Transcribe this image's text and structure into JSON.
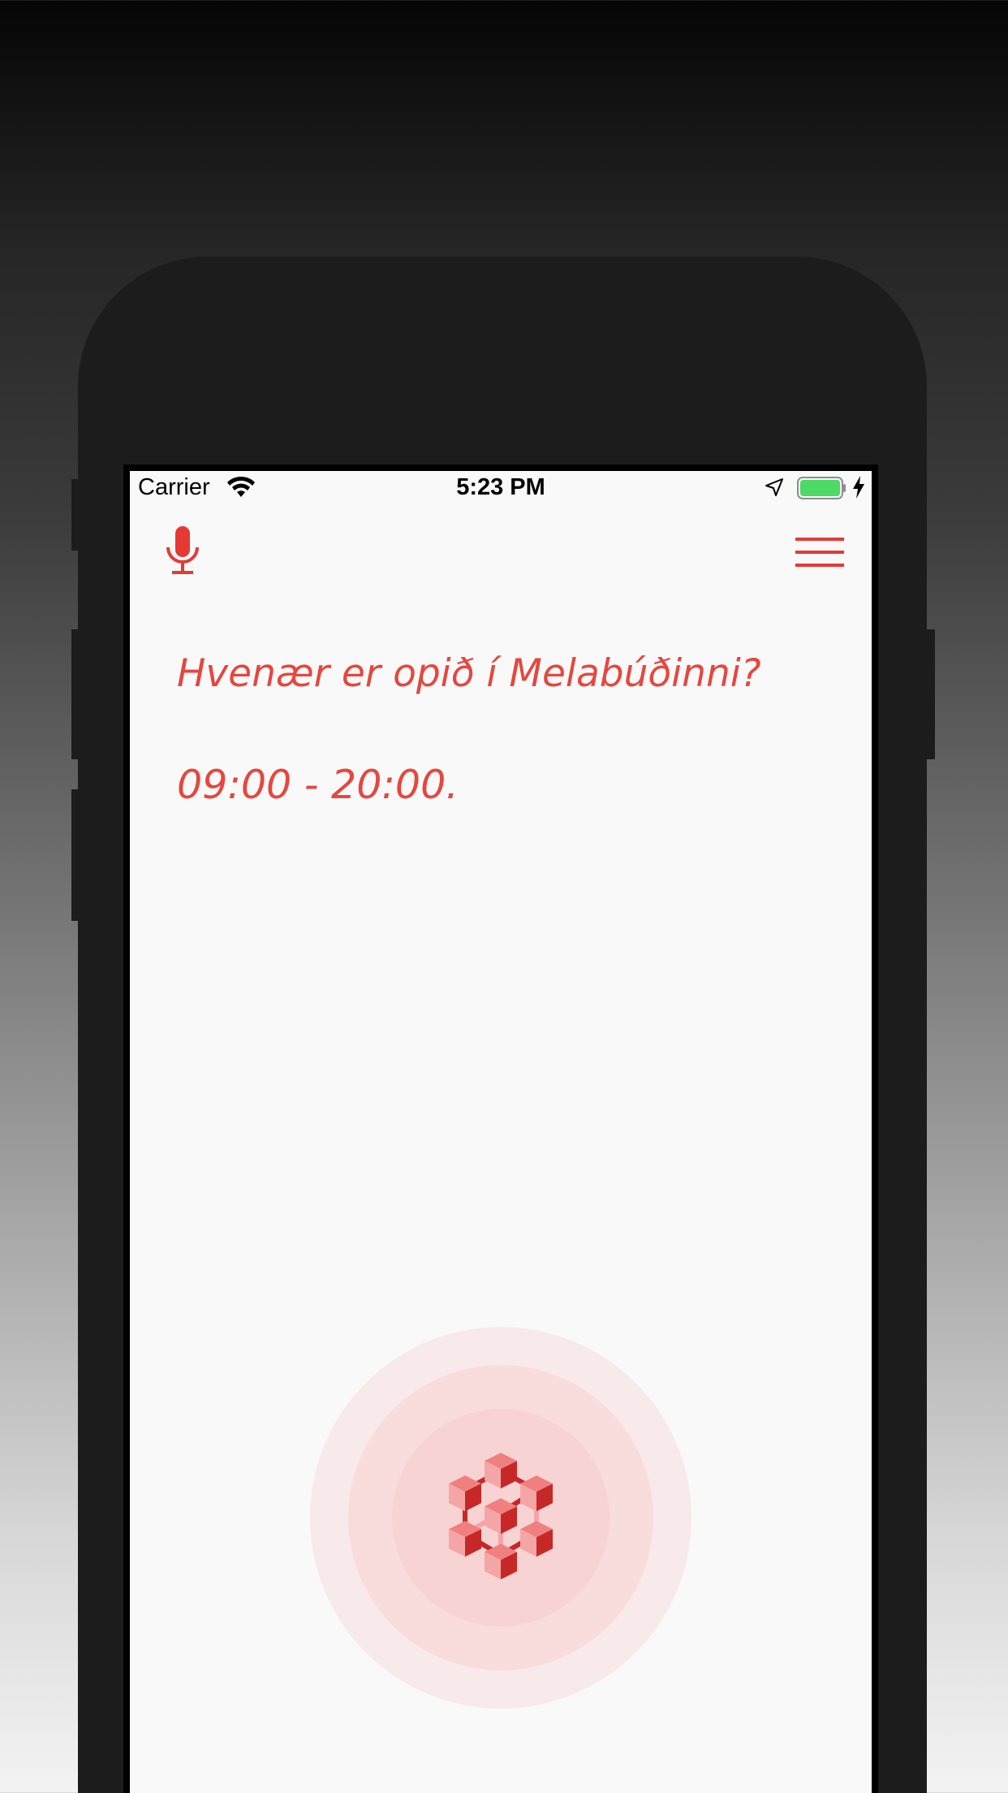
{
  "status_bar": {
    "carrier": "Carrier",
    "time": "5:23 PM"
  },
  "conversation": {
    "query": "Hvenær er opið í Melabúðinni?",
    "answer": "09:00 - 20:00."
  },
  "icons": {
    "mic": "microphone-icon",
    "menu": "hamburger-menu-icon",
    "logo": "cube-network-logo-icon",
    "wifi": "wifi-icon",
    "location": "location-arrow-icon",
    "battery": "battery-icon",
    "charging": "charging-bolt-icon"
  },
  "colors": {
    "accent": "#e5473f",
    "screen_background": "#f9f9f9",
    "battery_fill": "#4cd964"
  },
  "battery": {
    "level": 1.0
  }
}
